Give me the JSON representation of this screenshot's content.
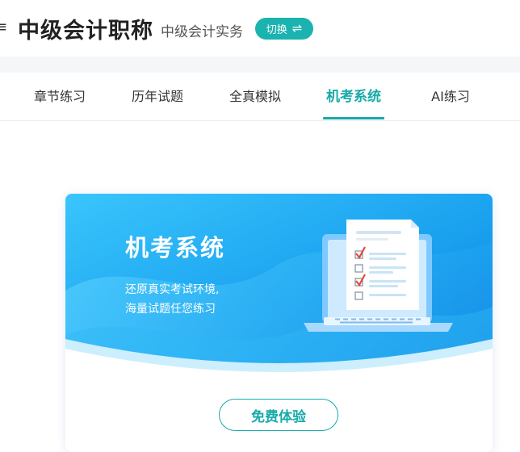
{
  "header": {
    "edge_glyph": "≡",
    "title": "中级会计职称",
    "subject": "中级会计实务",
    "switch_label": "切换",
    "switch_icon": "⇌"
  },
  "tabs": [
    {
      "label": "章节练习",
      "active": false
    },
    {
      "label": "历年试题",
      "active": false
    },
    {
      "label": "全真模拟",
      "active": false
    },
    {
      "label": "机考系统",
      "active": true
    },
    {
      "label": "AI练习",
      "active": false
    }
  ],
  "card": {
    "title": "机考系统",
    "description_line1": "还原真实考试环境,",
    "description_line2": "海量试题任您练习",
    "trial_button": "免费体验",
    "illustration": "laptop-exam-icon"
  },
  "colors": {
    "accent": "#17aaa8",
    "switch_bg": "#1bb3b0",
    "banner_blue": "#1aa0ee",
    "banner_light": "#34c3fb"
  }
}
